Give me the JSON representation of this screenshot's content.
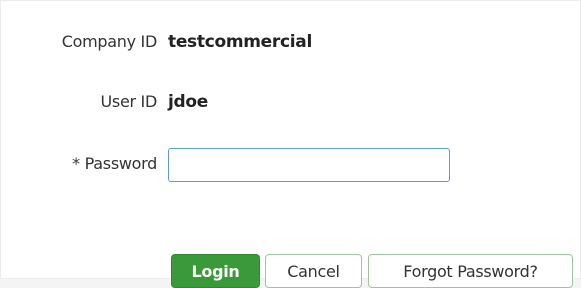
{
  "form": {
    "company": {
      "label": "Company ID",
      "value": "testcommercial"
    },
    "user": {
      "label": "User ID",
      "value": "jdoe"
    },
    "password": {
      "label": "* Password",
      "value": ""
    }
  },
  "buttons": {
    "login": "Login",
    "cancel": "Cancel",
    "forgot": "Forgot Password?"
  },
  "colors": {
    "login_bg": "#3a9a3a",
    "secondary_border": "#9cc79c",
    "input_border": "#5b9bd5"
  }
}
